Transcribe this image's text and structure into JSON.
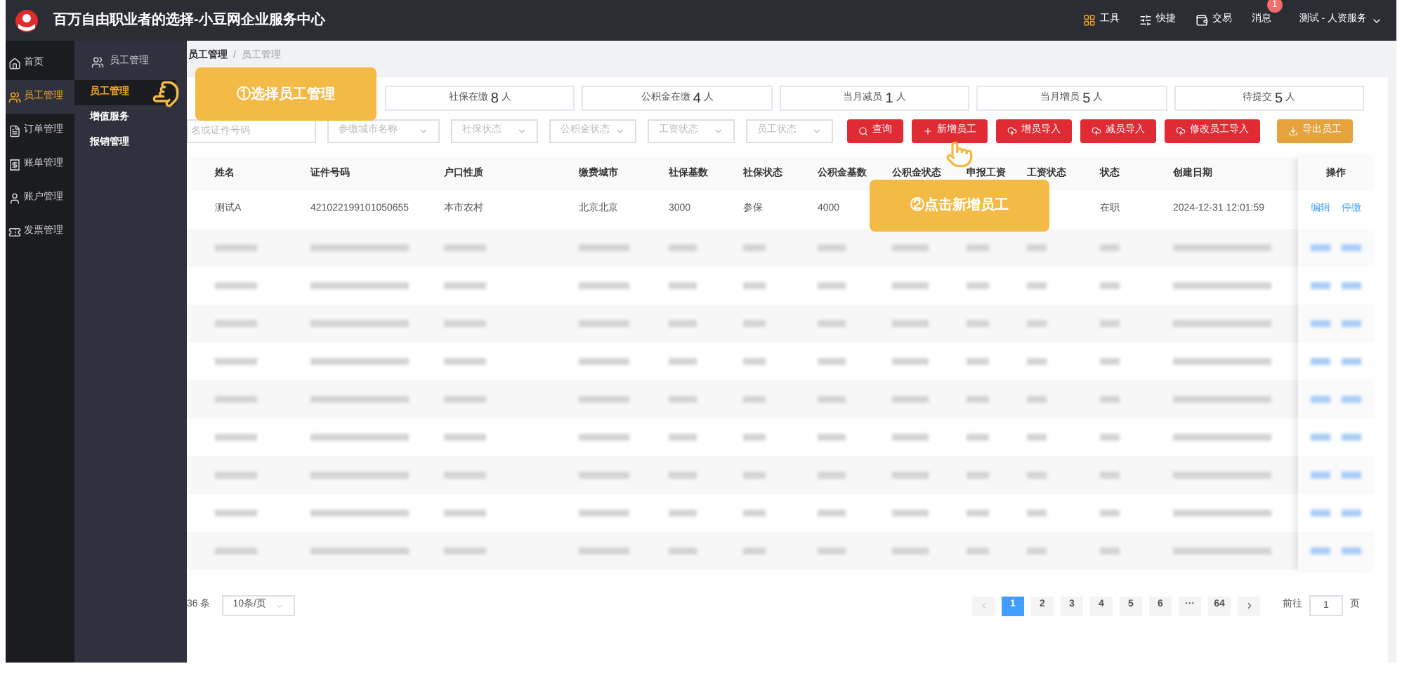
{
  "topbar": {
    "title": "百万自由职业者的选择-小豆网企业服务中心",
    "actions": [
      {
        "kind": "tools",
        "label": "工具"
      },
      {
        "kind": "shortcut",
        "label": "快捷"
      },
      {
        "kind": "trade",
        "label": "交易"
      },
      {
        "kind": "message",
        "label": "消息",
        "badge": "1"
      }
    ],
    "user": "测试 - 人资服务"
  },
  "nav": [
    {
      "kind": "home",
      "label": "首页",
      "selected": false
    },
    {
      "kind": "staff",
      "label": "员工管理",
      "selected": true
    },
    {
      "kind": "order",
      "label": "订单管理",
      "selected": false
    },
    {
      "kind": "bill",
      "label": "账单管理",
      "selected": false
    },
    {
      "kind": "account",
      "label": "账户管理",
      "selected": false
    },
    {
      "kind": "invoice",
      "label": "发票管理",
      "selected": false
    }
  ],
  "submenu": {
    "title": "员工管理",
    "items": [
      {
        "label": "员工管理",
        "selected": true
      },
      {
        "label": "增值服务",
        "selected": false
      },
      {
        "label": "报销管理",
        "selected": false
      }
    ]
  },
  "breadcrumb": {
    "items": [
      "员工管理",
      "员工管理"
    ],
    "separator": "/"
  },
  "stats": [
    {
      "label": "社保在缴",
      "value": "8",
      "unit": "人"
    },
    {
      "label": "公积金在缴",
      "value": "4",
      "unit": "人"
    },
    {
      "label": "当月减员",
      "value": "1",
      "unit": "人"
    },
    {
      "label": "当月增员",
      "value": "5",
      "unit": "人"
    },
    {
      "label": "待提交",
      "value": "5",
      "unit": "人"
    }
  ],
  "filters": [
    {
      "kind": "input",
      "placeholder": "名或证件号码"
    },
    {
      "kind": "select",
      "placeholder": "参缴城市名称"
    },
    {
      "kind": "select",
      "placeholder": "社保状态"
    },
    {
      "kind": "select",
      "placeholder": "公积金状态"
    },
    {
      "kind": "select",
      "placeholder": "工资状态"
    },
    {
      "kind": "select",
      "placeholder": "员工状态"
    }
  ],
  "buttons": [
    {
      "kind": "search",
      "label": "查询"
    },
    {
      "kind": "add",
      "label": "新增员工"
    },
    {
      "kind": "upload",
      "label": "增员导入"
    },
    {
      "kind": "upload",
      "label": "减员导入"
    },
    {
      "kind": "upload",
      "label": "修改员工导入"
    },
    {
      "kind": "export",
      "label": "导出员工"
    }
  ],
  "table": {
    "columns": [
      "姓名",
      "证件号码",
      "户口性质",
      "缴费城市",
      "社保基数",
      "社保状态",
      "公积金基数",
      "公积金状态",
      "申报工资",
      "工资状态",
      "状态",
      "创建日期",
      "操作"
    ],
    "rows": [
      {
        "kind": "data",
        "cells": [
          "测试A",
          "421022199101050655",
          "本市农村",
          "北京北京",
          "3000",
          "参保",
          "4000",
          "",
          "",
          "",
          "在职",
          "2024-12-31 12:01:59"
        ],
        "actions": [
          "编辑",
          "停缴"
        ]
      },
      {
        "kind": "blurred"
      },
      {
        "kind": "blurred"
      },
      {
        "kind": "blurred"
      },
      {
        "kind": "blurred"
      },
      {
        "kind": "blurred"
      },
      {
        "kind": "blurred"
      },
      {
        "kind": "blurred"
      },
      {
        "kind": "blurred"
      },
      {
        "kind": "blurred"
      }
    ]
  },
  "pagination": {
    "total": "36 条",
    "page_size": "10条/页",
    "pages": [
      {
        "label": "1",
        "selected": true
      },
      {
        "label": "2",
        "selected": false
      },
      {
        "label": "3",
        "selected": false
      },
      {
        "label": "4",
        "selected": false
      },
      {
        "label": "5",
        "selected": false
      },
      {
        "label": "6",
        "selected": false
      },
      {
        "label": "···",
        "selected": false
      },
      {
        "label": "64",
        "selected": false
      }
    ],
    "goto_label": "前往",
    "goto_value": "1",
    "goto_unit": "页"
  },
  "callouts": [
    {
      "text": "①选择员工管理"
    },
    {
      "text": "②点击新增员工"
    }
  ]
}
